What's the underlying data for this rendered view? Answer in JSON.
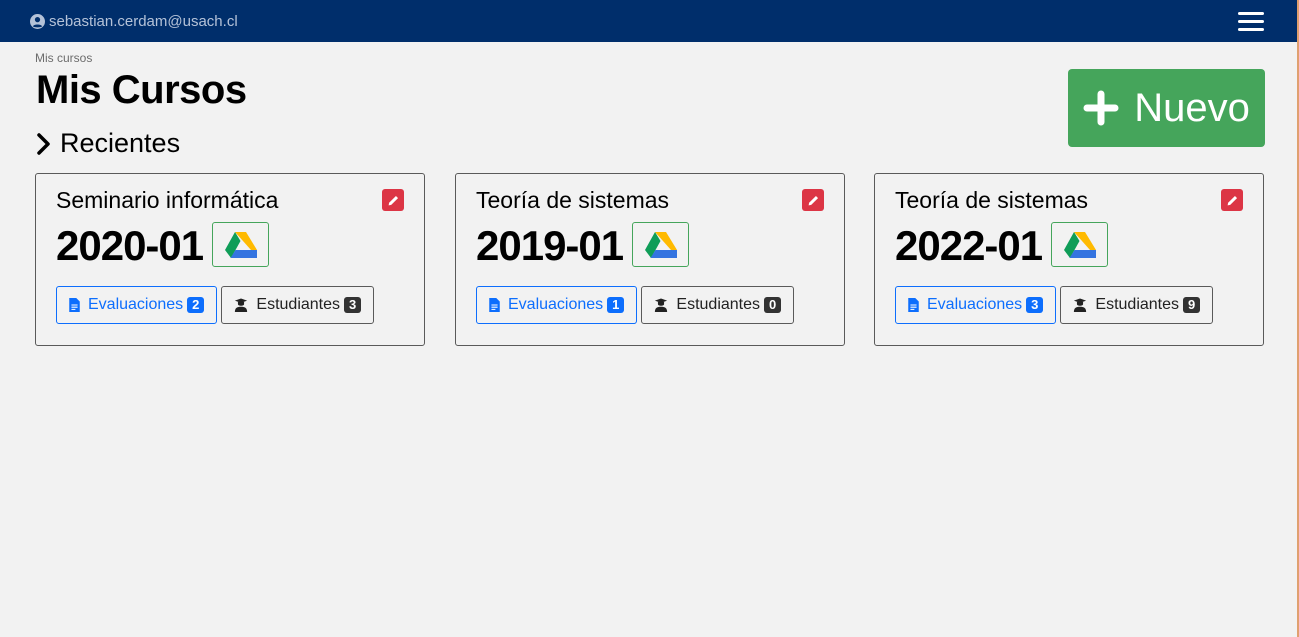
{
  "navbar": {
    "user_email": "sebastian.cerdam@usach.cl",
    "user_icon": "user-circle-icon",
    "menu_icon": "hamburger-icon"
  },
  "breadcrumb": "Mis cursos",
  "page_title": "Mis Cursos",
  "section": {
    "label": "Recientes",
    "icon": "chevron-right-icon"
  },
  "new_button": {
    "label": "Nuevo",
    "icon": "plus-icon"
  },
  "courses": [
    {
      "name": "Seminario informática",
      "period": "2020-01",
      "evaluations_label": "Evaluaciones",
      "evaluations_count": "2",
      "students_label": "Estudiantes",
      "students_count": "3"
    },
    {
      "name": "Teoría de sistemas",
      "period": "2019-01",
      "evaluations_label": "Evaluaciones",
      "evaluations_count": "1",
      "students_label": "Estudiantes",
      "students_count": "0"
    },
    {
      "name": "Teoría de sistemas",
      "period": "2022-01",
      "evaluations_label": "Evaluaciones",
      "evaluations_count": "3",
      "students_label": "Estudiantes",
      "students_count": "9"
    }
  ],
  "colors": {
    "navbar": "#002e6b",
    "new_button": "#45a55b",
    "edit_button": "#dc3545",
    "evaluations": "#0d6efd",
    "badge_dark": "#333333"
  }
}
